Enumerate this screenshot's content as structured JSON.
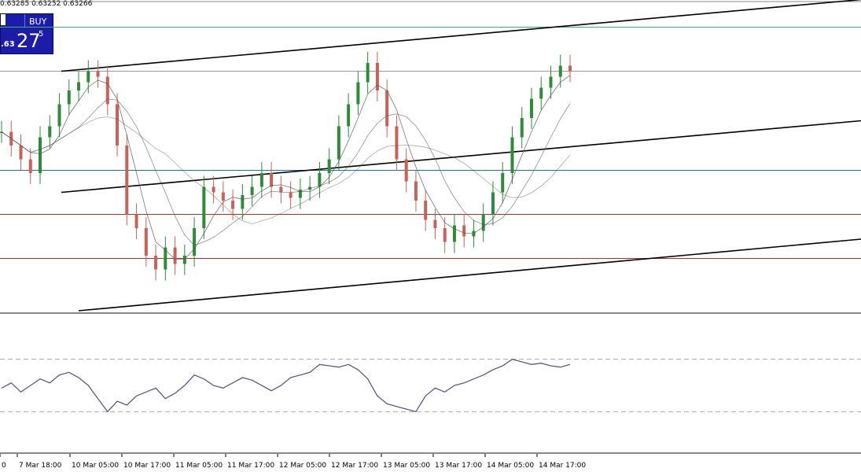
{
  "header": {
    "price_text": "0.63285 0.63252 0.63266"
  },
  "buy_panel": {
    "label": "BUY",
    "price_small": ".63",
    "price_big": "27",
    "price_sup": "5"
  },
  "chart_data": {
    "type": "candlestick",
    "x_tick_labels": [
      "0",
      "7 Mar 18:00",
      "10 Mar 05:00",
      "10 Mar 17:00",
      "11 Mar 05:00",
      "11 Mar 17:00",
      "12 Mar 05:00",
      "12 Mar 17:00",
      "13 Mar 05:00",
      "13 Mar 17:00",
      "14 Mar 05:00",
      "14 Mar 17:00"
    ],
    "price_series_approx": [
      0.626,
      0.6255,
      0.625,
      0.6245,
      0.6258,
      0.6262,
      0.627,
      0.6275,
      0.6278,
      0.6282,
      0.628,
      0.627,
      0.6255,
      0.623,
      0.6225,
      0.6215,
      0.621,
      0.6218,
      0.6212,
      0.6215,
      0.6225,
      0.624,
      0.6238,
      0.6235,
      0.6232,
      0.6237,
      0.624,
      0.6245,
      0.624,
      0.6238,
      0.6236,
      0.6239,
      0.624,
      0.6245,
      0.625,
      0.6262,
      0.627,
      0.6278,
      0.6285,
      0.6275,
      0.6262,
      0.625,
      0.6242,
      0.6235,
      0.6228,
      0.6225,
      0.622,
      0.6226,
      0.6222,
      0.6224,
      0.623,
      0.6238,
      0.6245,
      0.6258,
      0.6265,
      0.6272,
      0.6276,
      0.628,
      0.6284,
      0.6282
    ],
    "rsi_series_approx": [
      48,
      52,
      45,
      50,
      55,
      52,
      58,
      60,
      56,
      50,
      40,
      30,
      38,
      35,
      42,
      45,
      48,
      40,
      44,
      50,
      58,
      55,
      50,
      48,
      52,
      56,
      54,
      50,
      46,
      50,
      56,
      58,
      60,
      66,
      65,
      64,
      66,
      62,
      55,
      42,
      36,
      34,
      32,
      30,
      42,
      48,
      45,
      50,
      52,
      55,
      58,
      62,
      65,
      70,
      68,
      66,
      67,
      65,
      64,
      66
    ],
    "channel_lines": [
      {
        "name": "upper-channel",
        "y_start": 0.6282,
        "y_end": 0.6308
      },
      {
        "name": "middle-channel",
        "y_start": 0.6238,
        "y_end": 0.6264
      },
      {
        "name": "lower-channel",
        "y_start": 0.6195,
        "y_end": 0.6221
      }
    ],
    "horizontal_levels": [
      {
        "name": "green-level",
        "value": 0.6298,
        "color": "#3cb371"
      },
      {
        "name": "grey-level",
        "value": 0.6282,
        "color": "#9a9a9a"
      },
      {
        "name": "blue-level",
        "value": 0.6246,
        "color": "#1f6f9f"
      },
      {
        "name": "red-level-upper",
        "value": 0.623,
        "color": "#b03020"
      },
      {
        "name": "red-level-lower",
        "value": 0.6214,
        "color": "#b03020"
      }
    ],
    "price_range": [
      0.6195,
      0.6305
    ],
    "rsi_range": [
      20,
      80
    ],
    "rsi_levels": [
      70,
      30
    ],
    "colors": {
      "bull": "#2e8b3a",
      "bear": "#c8615a",
      "ma": "#555555",
      "rsi": "#5a5a8a"
    }
  }
}
